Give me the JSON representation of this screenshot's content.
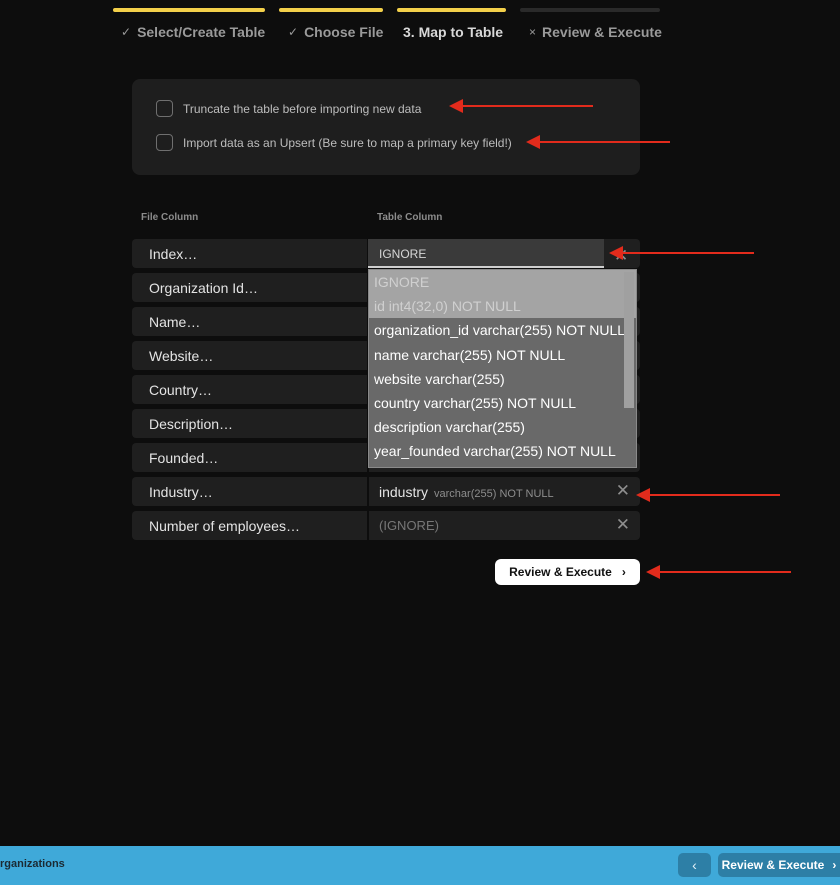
{
  "steps": [
    {
      "label": "Select/Create Table",
      "mark": "✓",
      "state": "done"
    },
    {
      "label": "Choose File",
      "mark": "✓",
      "state": "done"
    },
    {
      "label": "3. Map to Table",
      "mark": "",
      "state": "active"
    },
    {
      "label": "Review & Execute",
      "mark": "×",
      "state": "inactive"
    }
  ],
  "options": {
    "truncate_label": "Truncate the table before importing new data",
    "upsert_label": "Import data as an Upsert (Be sure to map a primary key field!)"
  },
  "headers": {
    "file_column": "File Column",
    "table_column": "Table Column"
  },
  "rows": [
    {
      "file": "Index…",
      "table": "IGNORE",
      "type": ""
    },
    {
      "file": "Organization Id…",
      "table": "",
      "type": ""
    },
    {
      "file": "Name…",
      "table": "",
      "type": ""
    },
    {
      "file": "Website…",
      "table": "",
      "type": ""
    },
    {
      "file": "Country…",
      "table": "",
      "type": ""
    },
    {
      "file": "Description…",
      "table": "",
      "type": ""
    },
    {
      "file": "Founded…",
      "table": "",
      "type": ""
    },
    {
      "file": "Industry…",
      "table": "industry",
      "type": "varchar(255) NOT NULL"
    },
    {
      "file": "Number of employees…",
      "table": "(IGNORE)",
      "type": ""
    }
  ],
  "dropdown": {
    "items": [
      {
        "label": "IGNORE",
        "disabled": true
      },
      {
        "label": "id int4(32,0) NOT NULL",
        "disabled": true
      },
      {
        "label": "organization_id varchar(255) NOT NULL",
        "disabled": false
      },
      {
        "label": "name varchar(255) NOT NULL",
        "disabled": false
      },
      {
        "label": "website varchar(255)",
        "disabled": false
      },
      {
        "label": "country varchar(255) NOT NULL",
        "disabled": false
      },
      {
        "label": "description varchar(255)",
        "disabled": false
      },
      {
        "label": "year_founded varchar(255) NOT NULL",
        "disabled": false
      }
    ]
  },
  "clear_glyph": "✕",
  "review_button": {
    "label": "Review & Execute",
    "icon": "chevron-right-icon",
    "glyph": "›"
  },
  "footer": {
    "crumb": "rganizations",
    "back_glyph": "‹",
    "next_label": "Review & Execute",
    "next_glyph": "›"
  },
  "colors": {
    "accent": "#f3d04a",
    "annotation_arrow": "#e22b1c",
    "footer_bg": "#3fa9d9",
    "footer_button": "#2d7fa6"
  }
}
